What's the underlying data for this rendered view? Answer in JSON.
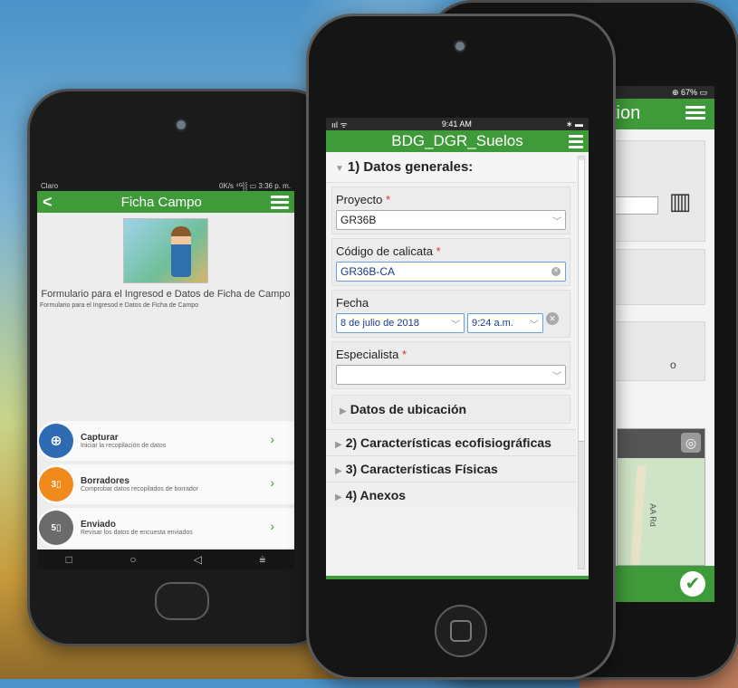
{
  "left_phone": {
    "status": {
      "carrier": "Claro",
      "right": "0K/s ⁴ᴳ⸾⸾ ▭ 3:36 p. m."
    },
    "appbar": {
      "back": "<",
      "title": "Ficha Campo"
    },
    "form_title": "Formulario para el Ingresod e Datos de Ficha de Campo",
    "form_subtitle": "Formulario para el Ingresod e Datos de Ficha de Campo",
    "menu": [
      {
        "title": "Capturar",
        "subtitle": "Iniciar la recopilación de datos",
        "color": "#2f6bb3",
        "badge": ""
      },
      {
        "title": "Borradores",
        "subtitle": "Comprobar datos recopilados de borrador",
        "color": "#f08a1c",
        "badge": "3"
      },
      {
        "title": "Enviado",
        "subtitle": "Revisar los datos de encuesta enviados",
        "color": "#6b6b6b",
        "badge": "5"
      }
    ],
    "navbar": [
      "□",
      "○",
      "◁",
      "⩧"
    ]
  },
  "middle_phone": {
    "status": {
      "signal": "ııl ᯤ",
      "time": "9:41 AM",
      "right": "∗ ▬"
    },
    "appbar": {
      "title": "BDG_DGR_Suelos"
    },
    "section1": "1) Datos generales:",
    "fields": {
      "proyecto_label": "Proyecto",
      "proyecto_value": "GR36B",
      "codigo_label": "Código de calicata",
      "codigo_value": "GR36B-CA",
      "fecha_label": "Fecha",
      "fecha_date": "8 de julio de 2018",
      "fecha_time": "9:24 a.m.",
      "especialista_label": "Especialista",
      "especialista_value": "",
      "required_mark": "*"
    },
    "subsection": "Datos de ubicación",
    "section2": "2) Características ecofisiográficas",
    "section3": "3) Características Físicas",
    "section4": "4) Anexos"
  },
  "right_phone": {
    "status": "⊕ 67% ▭",
    "appbar_title": "ction",
    "map_road_label": "AA Rd",
    "partial_text": "o"
  },
  "colors": {
    "green": "#3f9b3a",
    "blue": "#2f6bb3",
    "orange": "#f08a1c",
    "gray": "#6b6b6b"
  }
}
